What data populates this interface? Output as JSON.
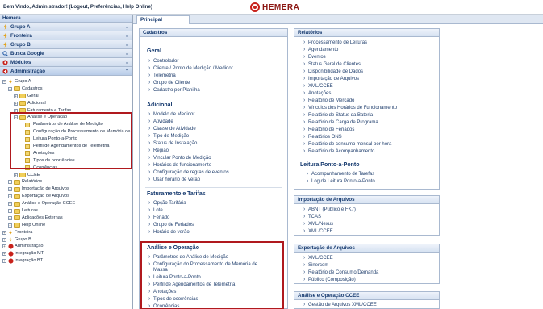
{
  "header": {
    "welcome_text": "Bem Vindo, Administrador! (Logout, Preferências, Help Online)",
    "logo_text": "HEMERA",
    "brand_color": "#c8221b"
  },
  "sidebar": {
    "title": "Hemera",
    "panels": [
      {
        "label": "Grupo A",
        "icon": "bolt-icon"
      },
      {
        "label": "Fronteira",
        "icon": "bolt-icon"
      },
      {
        "label": "Grupo B",
        "icon": "bolt-icon"
      },
      {
        "label": "Busca Google",
        "icon": "search-icon"
      },
      {
        "label": "Módulos",
        "icon": "modules-icon"
      },
      {
        "label": "Administração",
        "icon": "admin-icon"
      }
    ],
    "tree": {
      "grupo_a": "Grupo A",
      "cadastros": "Cadastros",
      "geral": "Geral",
      "adicional": "Adicional",
      "faturamento": "Faturamento e Tarifas",
      "analise": "Análise e Operação",
      "analise_children": [
        "Parâmetros de Análise de Medição",
        "Configuração do Processamento de Memória de Massa",
        "Leitura Ponto-a-Ponto",
        "Perfil de Agendamentos de Telemetria",
        "Anotações",
        "Tipos de ocorrências",
        "Ocorrências"
      ],
      "ccee": "CCEE",
      "relatorios": "Relatórios",
      "importacao": "Importação de Arquivos",
      "exportacao": "Exportação de Arquivos",
      "analise_ccee": "Análise e Operação CCEE",
      "leituras": "Leituras",
      "aplicacoes": "Aplicações Externas",
      "help": "Help Online",
      "fronteira": "Fronteira",
      "grupo_b": "Grupo B",
      "administracao": "Administração",
      "integracao_mt": "Integração MT",
      "integracao_bt": "Integração BT"
    }
  },
  "tabs": {
    "principal": "Principal"
  },
  "cadastros": {
    "title": "Cadastros",
    "geral": {
      "title": "Geral",
      "items": [
        "Controlador",
        "Cliente / Ponto de Medição / Medidor",
        "Telemetria",
        "Grupo de Cliente",
        "Cadastro por Planilha"
      ]
    },
    "adicional": {
      "title": "Adicional",
      "items": [
        "Modelo de Medidor",
        "Atividade",
        "Classe de Atividade",
        "Tipo de Medição",
        "Status de Instalação",
        "Região",
        "Vincular Ponto de Medição",
        "Horários de funcionamento",
        "Configuração de regras de eventos",
        "Usar horário de verão"
      ]
    },
    "faturamento": {
      "title": "Faturamento e Tarifas",
      "items": [
        "Opção Tarifária",
        "Lote",
        "Feriado",
        "Grupo de Feriados",
        "Horário de verão"
      ]
    },
    "analise": {
      "title": "Análise e Operação",
      "items": [
        "Parâmetros de Análise de Medição",
        "Configuração do Processamento de Memória de",
        "Massa",
        "Leitura Ponto-a-Ponto",
        "Perfil de Agendamentos de Telemetria",
        "Anotações",
        "Tipos de ocorrências",
        "Ocorrências"
      ]
    }
  },
  "relatorios": {
    "title": "Relatórios",
    "items": [
      "Processamento de Leituras",
      "Agendamento",
      "Eventos",
      "Status Geral de Clientes",
      "Disponibilidade de Dados",
      "Importação de Arquivos",
      "XML/CCEE",
      "Anotações",
      "Relatório de Mercado",
      "Vínculos dos Horários de Funcionamento",
      "Relatório de Status da Bateria",
      "Relatório de Carga de Programa",
      "Relatório de Feriados",
      "Relatórios ONS",
      "Relatório de consumo mensal por hora",
      "Relatório de Acompanhamento"
    ],
    "leitura_title": "Leitura Ponto-a-Ponto",
    "leitura_items": [
      "Acompanhamento de Tarefas",
      "Log de Leitura Ponto-a-Ponto"
    ]
  },
  "importacao": {
    "title": "Importação de Arquivos",
    "items": [
      "ABNT (Público e FK7)",
      "TCAS",
      "XML/Nexus",
      "XML/CCEE"
    ]
  },
  "exportacao": {
    "title": "Exportação de Arquivos",
    "items": [
      "XML/CCEE",
      "Sinercom",
      "Relatório de Consumo/Demanda",
      "Público (Composição)"
    ]
  },
  "analise_ccee": {
    "title": "Análise e Operação CCEE",
    "items": [
      "Gestão de Arquivos XML/CCEE"
    ]
  }
}
